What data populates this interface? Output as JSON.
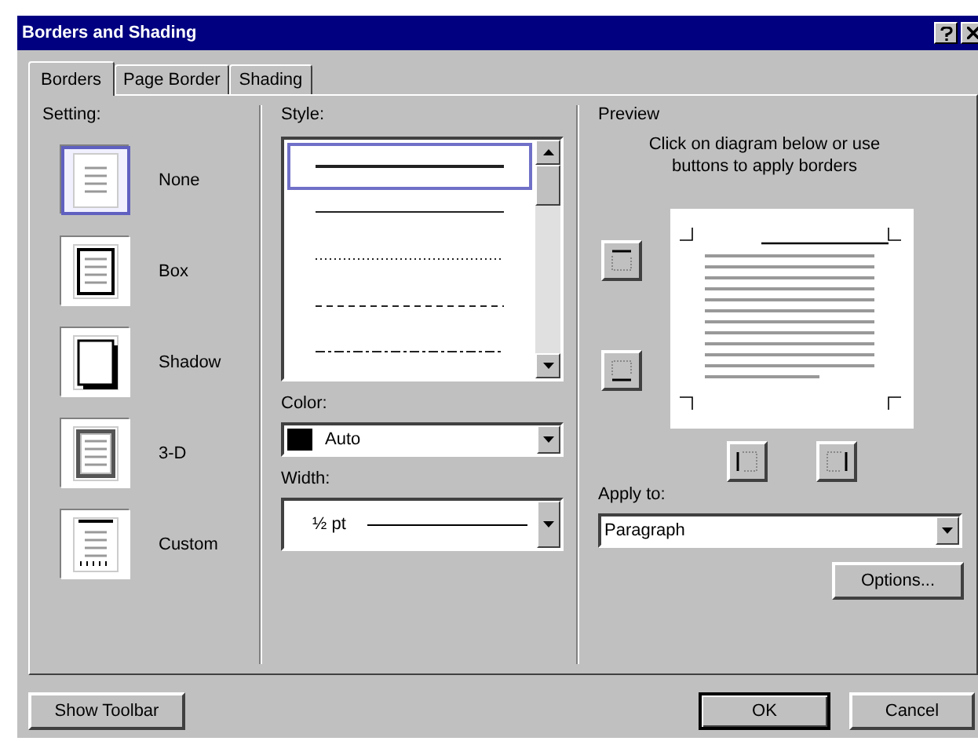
{
  "window": {
    "title": "Borders and Shading"
  },
  "tabs": [
    {
      "label": "Borders",
      "selected": true
    },
    {
      "label": "Page Border",
      "selected": false
    },
    {
      "label": "Shading",
      "selected": false
    }
  ],
  "setting": {
    "label": "Setting:",
    "items": [
      {
        "label": "None",
        "kind": "none",
        "selected": true
      },
      {
        "label": "Box",
        "kind": "box",
        "selected": false
      },
      {
        "label": "Shadow",
        "kind": "shadow",
        "selected": false
      },
      {
        "label": "3-D",
        "kind": "threed",
        "selected": false
      },
      {
        "label": "Custom",
        "kind": "custom",
        "selected": false
      }
    ]
  },
  "style": {
    "label": "Style:",
    "items": [
      {
        "kind": "solid",
        "selected": true
      },
      {
        "kind": "thin",
        "selected": false
      },
      {
        "kind": "dotted",
        "selected": false
      },
      {
        "kind": "dashed",
        "selected": false
      },
      {
        "kind": "dashdot",
        "selected": false
      }
    ]
  },
  "color": {
    "label": "Color:",
    "value": "Auto"
  },
  "width": {
    "label": "Width:",
    "value": "½ pt"
  },
  "preview": {
    "label": "Preview",
    "instructions": "Click on diagram below or use buttons to apply borders"
  },
  "apply_to": {
    "label": "Apply to:",
    "value": "Paragraph"
  },
  "buttons": {
    "options": "Options...",
    "show_toolbar": "Show Toolbar",
    "ok": "OK",
    "cancel": "Cancel"
  }
}
